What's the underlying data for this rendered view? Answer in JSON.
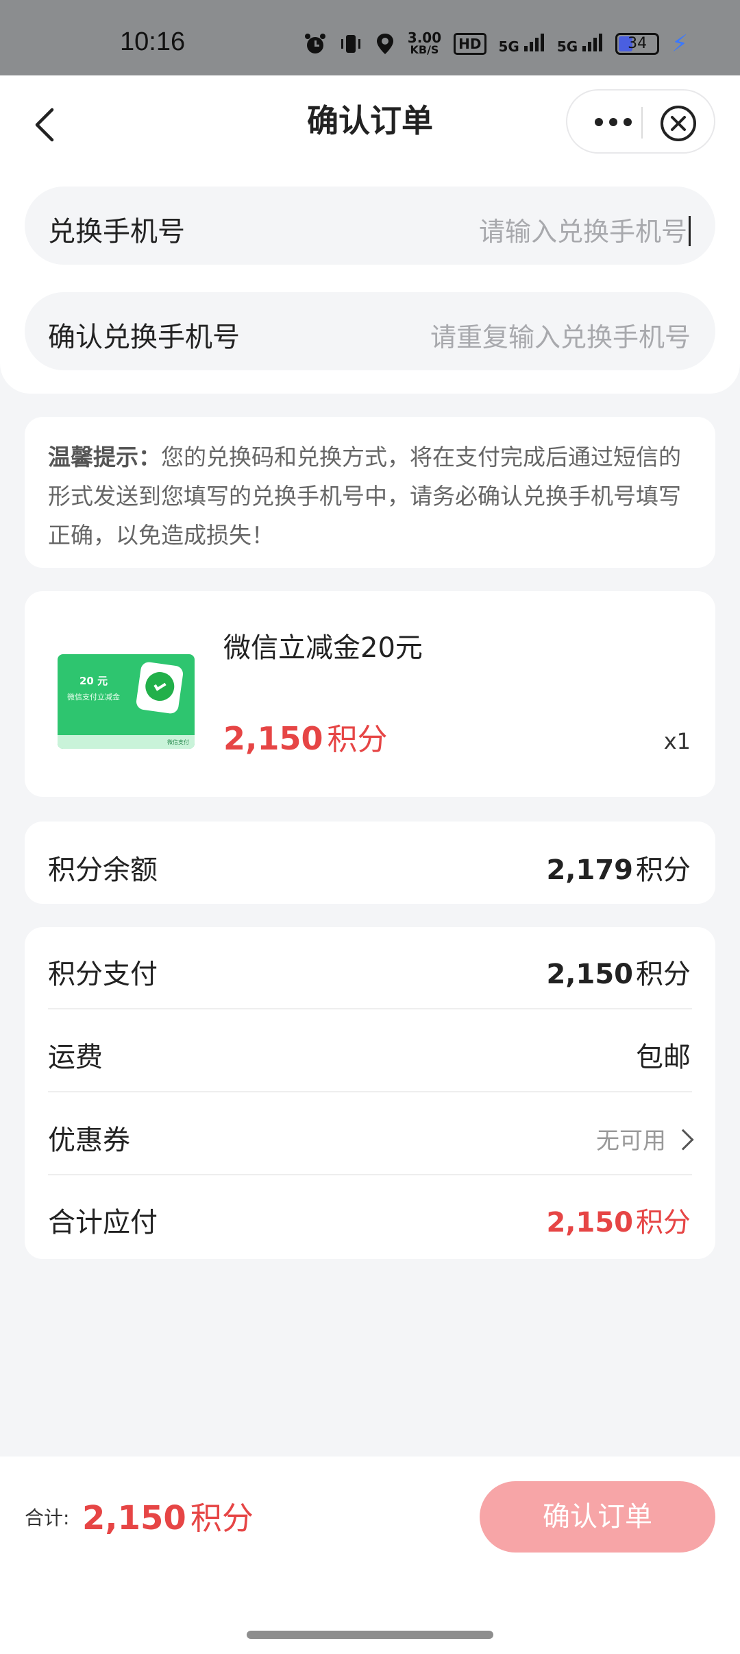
{
  "status_bar": {
    "time": "10:16",
    "net_speed_value": "3.00",
    "net_speed_unit": "KB/S",
    "hd_label": "HD",
    "signal_1": "5G",
    "signal_2": "5G",
    "battery": "34",
    "icons": [
      "alarm-icon",
      "vibrate-icon",
      "location-icon",
      "hd-icon",
      "signal-icon",
      "battery-icon",
      "charging-icon"
    ]
  },
  "nav": {
    "title": "确认订单",
    "back_icon": "chevron-left-icon",
    "more_icon": "more-dots-icon",
    "close_icon": "close-circle-icon"
  },
  "form": {
    "phone_label": "兑换手机号",
    "phone_placeholder": "请输入兑换手机号",
    "confirm_phone_label": "确认兑换手机号",
    "confirm_phone_placeholder": "请重复输入兑换手机号"
  },
  "tip": {
    "title": "温馨提示：",
    "text": "您的兑换码和兑换方式，将在支付完成后通过短信的形式发送到您填写的兑换手机号中，请务必确认兑换手机号填写正确，以免造成损失！"
  },
  "product": {
    "name": "微信立减金20元",
    "price": "2,150",
    "price_unit": "积分",
    "quantity": "x1",
    "thumb_amount": "20 元",
    "thumb_caption": "微信支付立减金",
    "thumb_brand": "微信支付"
  },
  "balance": {
    "label": "积分余额",
    "value": "2,179",
    "unit": "积分"
  },
  "summary": {
    "points_pay_label": "积分支付",
    "points_pay_value": "2,150",
    "points_pay_unit": "积分",
    "shipping_label": "运费",
    "shipping_value": "包邮",
    "coupon_label": "优惠券",
    "coupon_value": "无可用",
    "total_label": "合计应付",
    "total_value": "2,150",
    "total_unit": "积分"
  },
  "bottom": {
    "total_label": "合计:",
    "total_value": "2,150",
    "total_unit": "积分",
    "confirm_label": "确认订单"
  },
  "colors": {
    "accent_red": "#e64545",
    "button_pink": "#f7a5a7",
    "background": "#f4f5f7"
  }
}
